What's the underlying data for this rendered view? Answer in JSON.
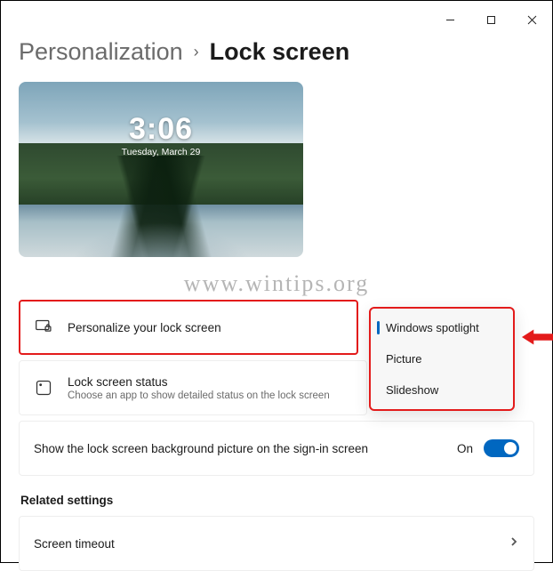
{
  "breadcrumb": {
    "parent": "Personalization",
    "current": "Lock screen"
  },
  "preview": {
    "time": "3:06",
    "date": "Tuesday, March 29"
  },
  "rows": {
    "personalize": {
      "title": "Personalize your lock screen"
    },
    "status": {
      "title": "Lock screen status",
      "subtitle": "Choose an app to show detailed status on the lock screen"
    },
    "signin": {
      "title": "Show the lock screen background picture on the sign-in screen",
      "toggle_label": "On",
      "toggle_on": true
    },
    "timeout": {
      "title": "Screen timeout"
    }
  },
  "dropdown": {
    "options": [
      "Windows spotlight",
      "Picture",
      "Slideshow"
    ],
    "selected_index": 0
  },
  "section": {
    "related": "Related settings"
  },
  "watermark": "www.wintips.org"
}
